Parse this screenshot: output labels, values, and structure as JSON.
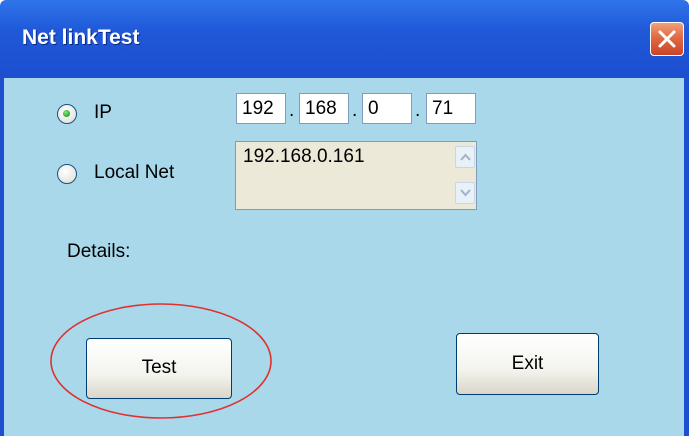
{
  "window": {
    "title": "Net linkTest"
  },
  "options": {
    "ip_label": "IP",
    "ip_selected": true,
    "local_net_label": "Local Net",
    "local_net_selected": false
  },
  "ip_address": {
    "octet1": "192",
    "octet2": "168",
    "octet3": "0",
    "octet4": "71",
    "separator": "."
  },
  "local_net": {
    "value": "192.168.0.161"
  },
  "details_label": "Details:",
  "buttons": {
    "test_label": "Test",
    "exit_label": "Exit"
  },
  "colors": {
    "titlebar": "#1f58d8",
    "client_bg": "#a8d8ea",
    "close_button": "#e06a44",
    "annotation_ellipse": "#e03030",
    "radio_dot": "#2bb32b"
  },
  "icons": {
    "close": "close-icon",
    "scroll_up": "chevron-up-icon",
    "scroll_down": "chevron-down-icon"
  }
}
